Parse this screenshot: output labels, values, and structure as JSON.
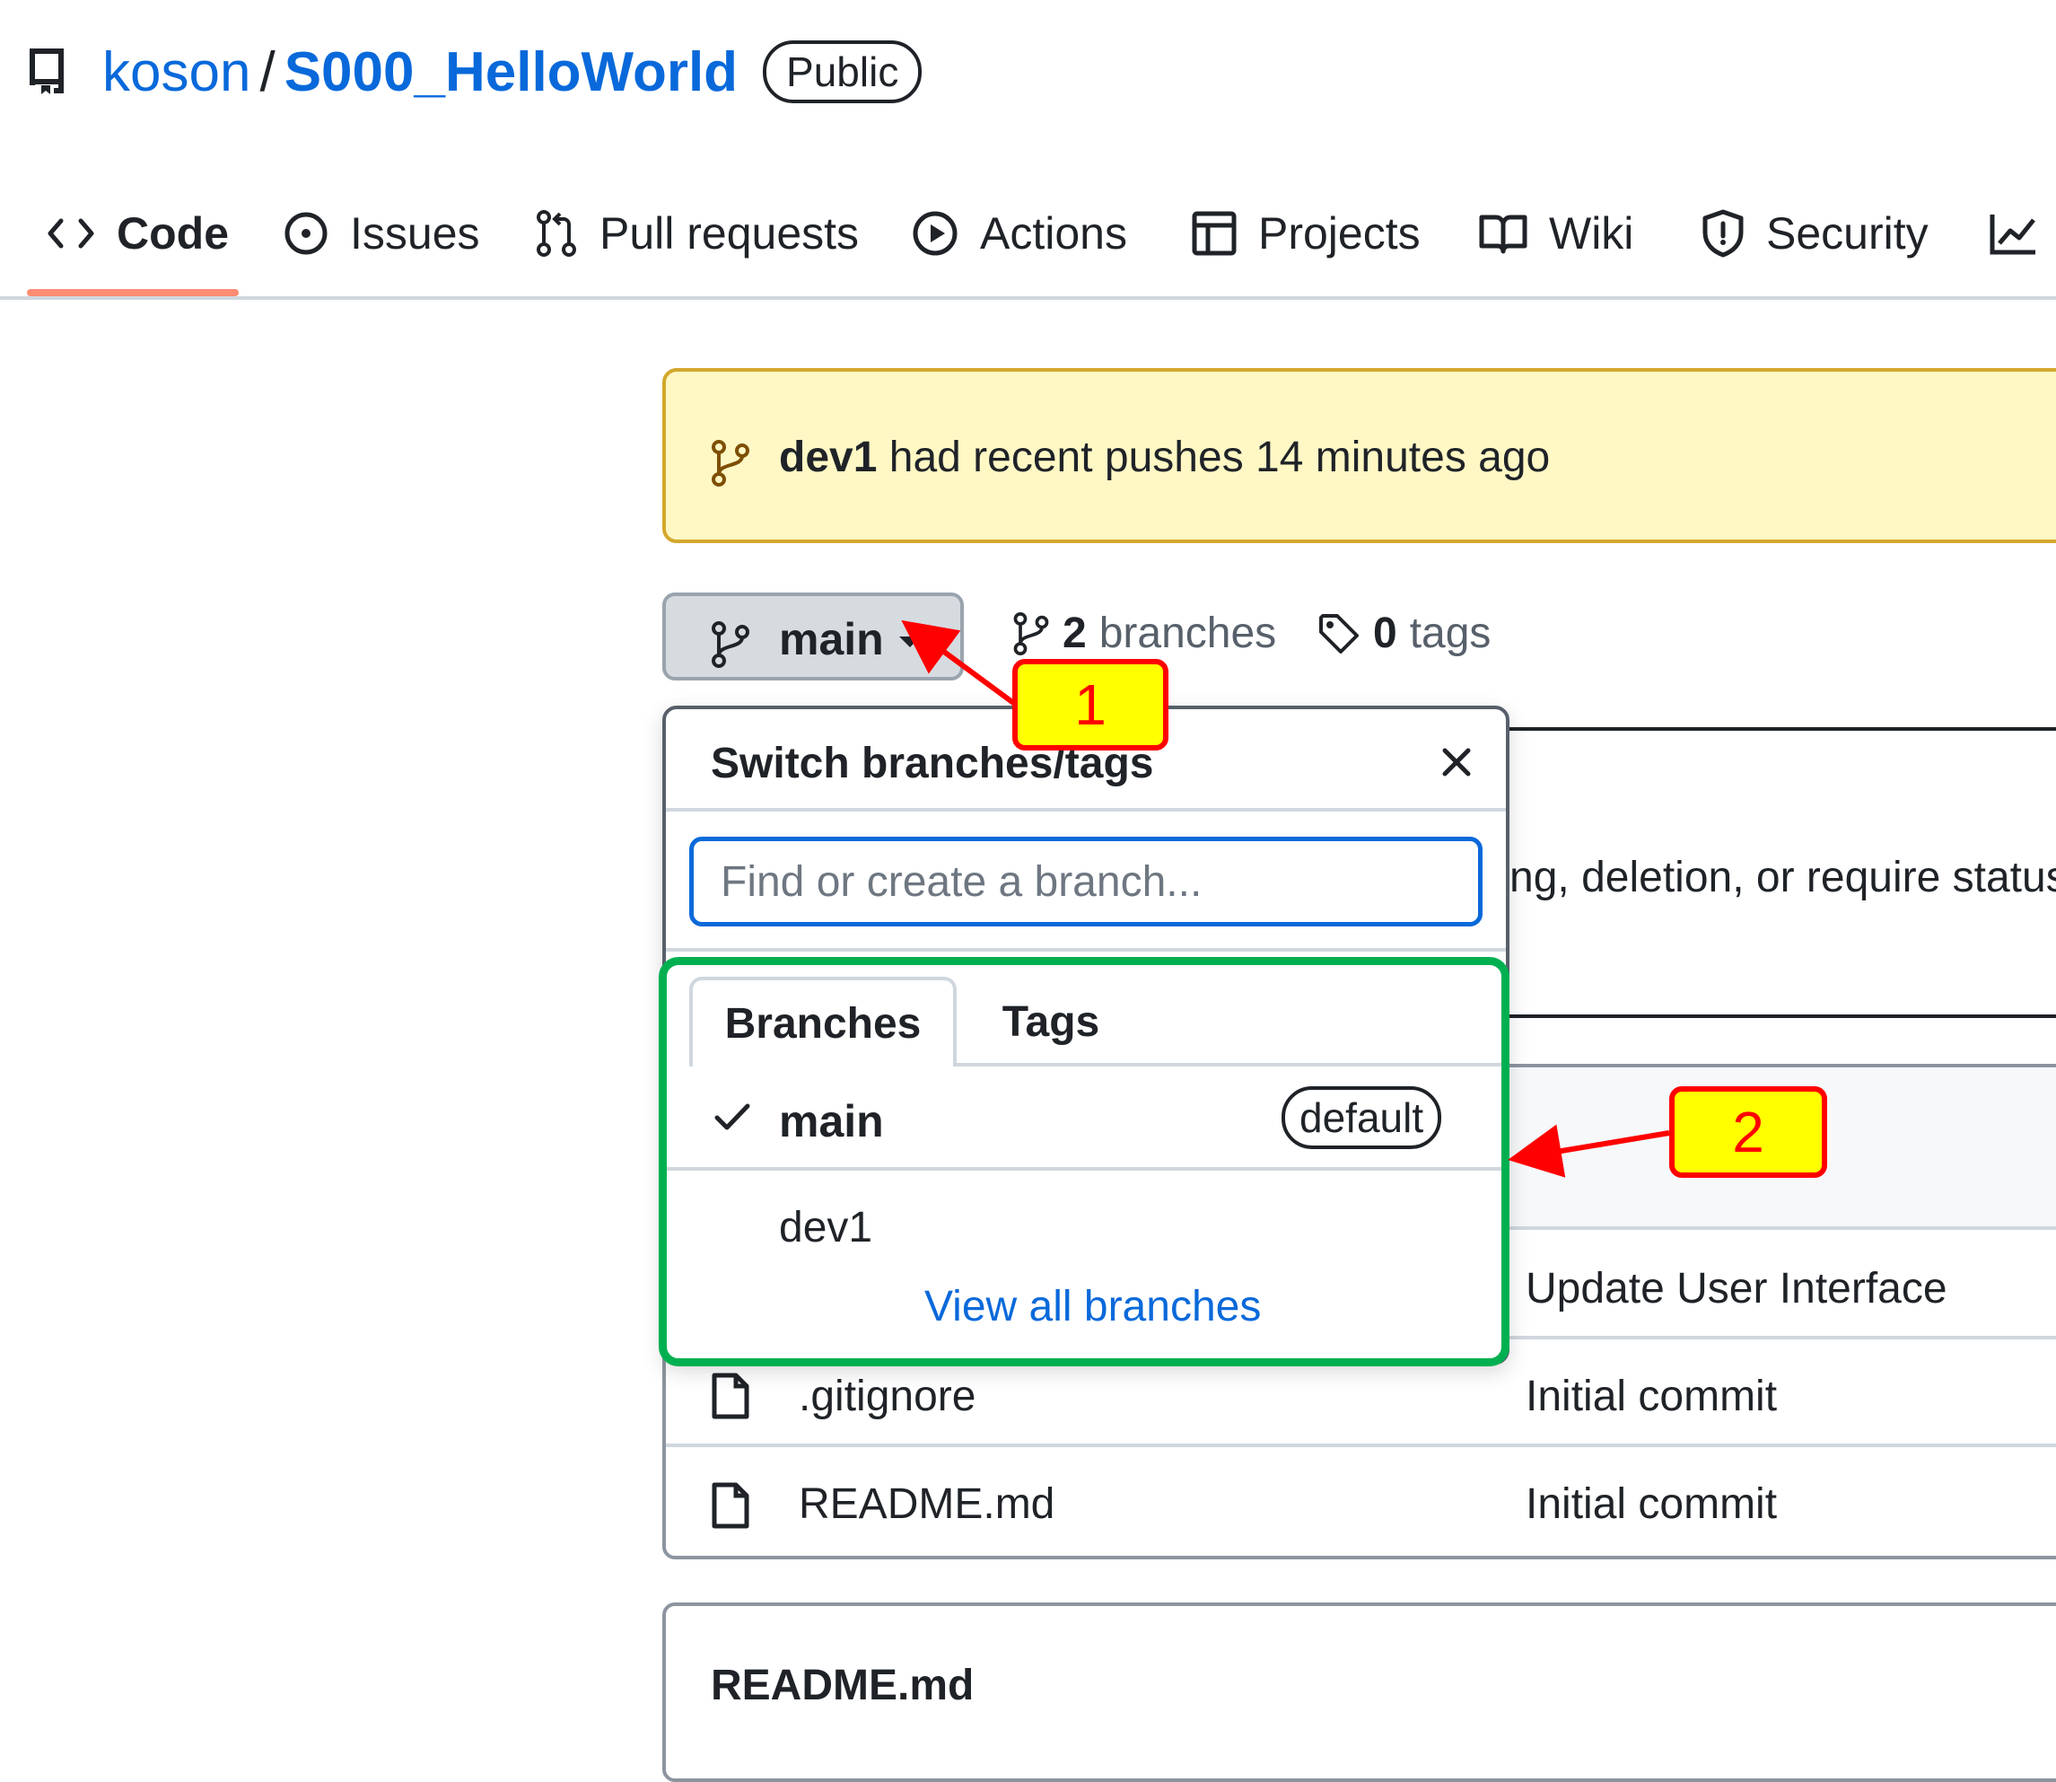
{
  "header": {
    "owner": "koson",
    "separator": "/",
    "repo_name": "S000_HelloWorld",
    "visibility": "Public"
  },
  "nav": {
    "tabs": [
      {
        "label": "Code",
        "icon": "code-icon",
        "active": true
      },
      {
        "label": "Issues",
        "icon": "issue-opened-icon"
      },
      {
        "label": "Pull requests",
        "icon": "git-pull-request-icon"
      },
      {
        "label": "Actions",
        "icon": "play-icon"
      },
      {
        "label": "Projects",
        "icon": "table-icon"
      },
      {
        "label": "Wiki",
        "icon": "book-icon"
      },
      {
        "label": "Security",
        "icon": "shield-icon"
      },
      {
        "label": "",
        "icon": "graph-icon"
      }
    ]
  },
  "banner": {
    "branch": "dev1",
    "message": "had recent pushes 14 minutes ago"
  },
  "branch_bar": {
    "current_branch": "main",
    "branches_count": "2",
    "branches_label": "branches",
    "tags_count": "0",
    "tags_label": "tags"
  },
  "background": {
    "protection_text": "ng, deletion, or require status",
    "files": [
      {
        "name": "",
        "commit": "Update User Interface"
      },
      {
        "name": ".gitignore",
        "commit": "Initial commit"
      },
      {
        "name": "README.md",
        "commit": "Initial commit"
      }
    ],
    "readme_title": "README.md"
  },
  "dropdown": {
    "title": "Switch branches/tags",
    "search_placeholder": "Find or create a branch...",
    "tabs": [
      "Branches",
      "Tags"
    ],
    "branches": [
      {
        "name": "main",
        "selected": true,
        "badge": "default"
      },
      {
        "name": "dev1",
        "selected": false
      }
    ],
    "view_all": "View all branches"
  },
  "annotations": {
    "callout_1": "1",
    "callout_2": "2",
    "arrow_color": "#ff0000",
    "box_color": "#00b050",
    "callout_fill": "#ffff00"
  },
  "colors": {
    "link": "#0969da",
    "banner_bg": "#fff8c5",
    "active_tab_underline": "#fd8c73"
  }
}
